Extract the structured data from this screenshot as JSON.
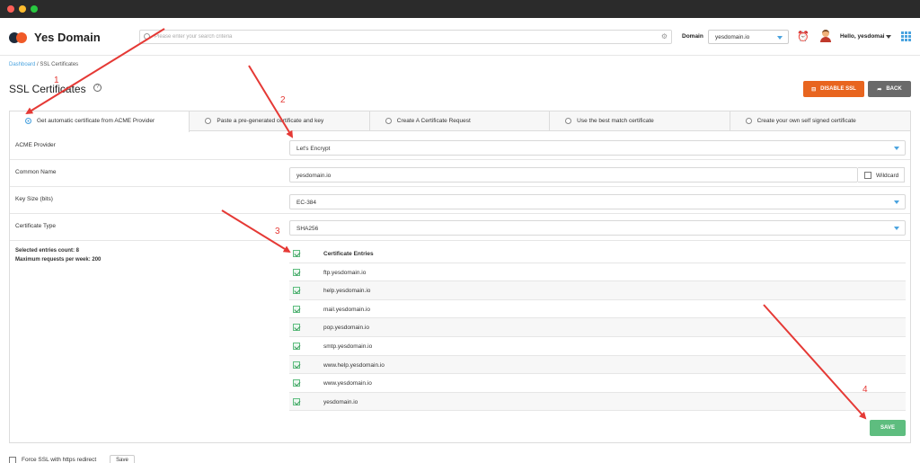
{
  "header": {
    "logo_text": "Yes Domain",
    "search_placeholder": "Please enter your search criteria",
    "domain_label": "Domain",
    "domain_value": "yesdomain.io",
    "user_greeting": "Hello, yesdomai"
  },
  "breadcrumb": {
    "parent": "Dashboard",
    "current": "SSL Certificates"
  },
  "page": {
    "title": "SSL Certificates",
    "help_icon": "?"
  },
  "actions": {
    "disable_ssl": "DISABLE SSL",
    "back": "BACK",
    "save": "SAVE"
  },
  "tabs": [
    {
      "label": "Get automatic certificate from ACME Provider",
      "selected": true
    },
    {
      "label": "Paste a pre-generated certificate and key",
      "selected": false
    },
    {
      "label": "Create A Certificate Request",
      "selected": false
    },
    {
      "label": "Use the best match certificate",
      "selected": false
    },
    {
      "label": "Create your own self signed certificate",
      "selected": false
    }
  ],
  "form": {
    "acme_provider": {
      "label": "ACME Provider",
      "value": "Let's Encrypt"
    },
    "common_name": {
      "label": "Common Name",
      "value": "yesdomain.io",
      "wildcard_label": "Wildcard"
    },
    "key_size": {
      "label": "Key Size (bits)",
      "value": "EC-384"
    },
    "certificate_type": {
      "label": "Certificate Type",
      "value": "SHA256"
    }
  },
  "summary": {
    "selected_count": "Selected entries count: 8",
    "max_requests": "Maximum requests per week: 200"
  },
  "entries": {
    "header": "Certificate Entries",
    "items": [
      "ftp.yesdomain.io",
      "help.yesdomain.io",
      "mail.yesdomain.io",
      "pop.yesdomain.io",
      "smtp.yesdomain.io",
      "www.help.yesdomain.io",
      "www.yesdomain.io",
      "yesdomain.io"
    ]
  },
  "footer": {
    "force_ssl_label": "Force SSL with https redirect",
    "save_label": "Save"
  },
  "annotations": {
    "step1": "1",
    "step2": "2",
    "step3": "3",
    "step4": "4"
  },
  "colors": {
    "accent": "#4aa3df",
    "orange": "#e8651f",
    "green": "#5ebd7f",
    "arrow": "#e53935"
  }
}
